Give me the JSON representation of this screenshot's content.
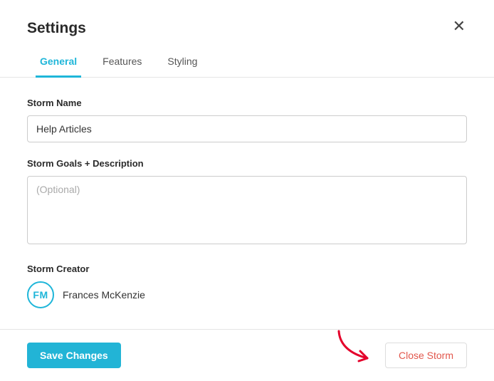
{
  "modal": {
    "title": "Settings",
    "tabs": [
      {
        "label": "General",
        "active": true
      },
      {
        "label": "Features",
        "active": false
      },
      {
        "label": "Styling",
        "active": false
      }
    ]
  },
  "form": {
    "storm_name": {
      "label": "Storm Name",
      "value": "Help Articles"
    },
    "storm_goals": {
      "label": "Storm Goals + Description",
      "placeholder": "(Optional)",
      "value": ""
    },
    "storm_creator": {
      "label": "Storm Creator",
      "initials": "FM",
      "name": "Frances McKenzie"
    }
  },
  "footer": {
    "save_label": "Save Changes",
    "close_storm_label": "Close Storm"
  },
  "colors": {
    "accent": "#1fb6d9",
    "danger": "#e2574c"
  }
}
